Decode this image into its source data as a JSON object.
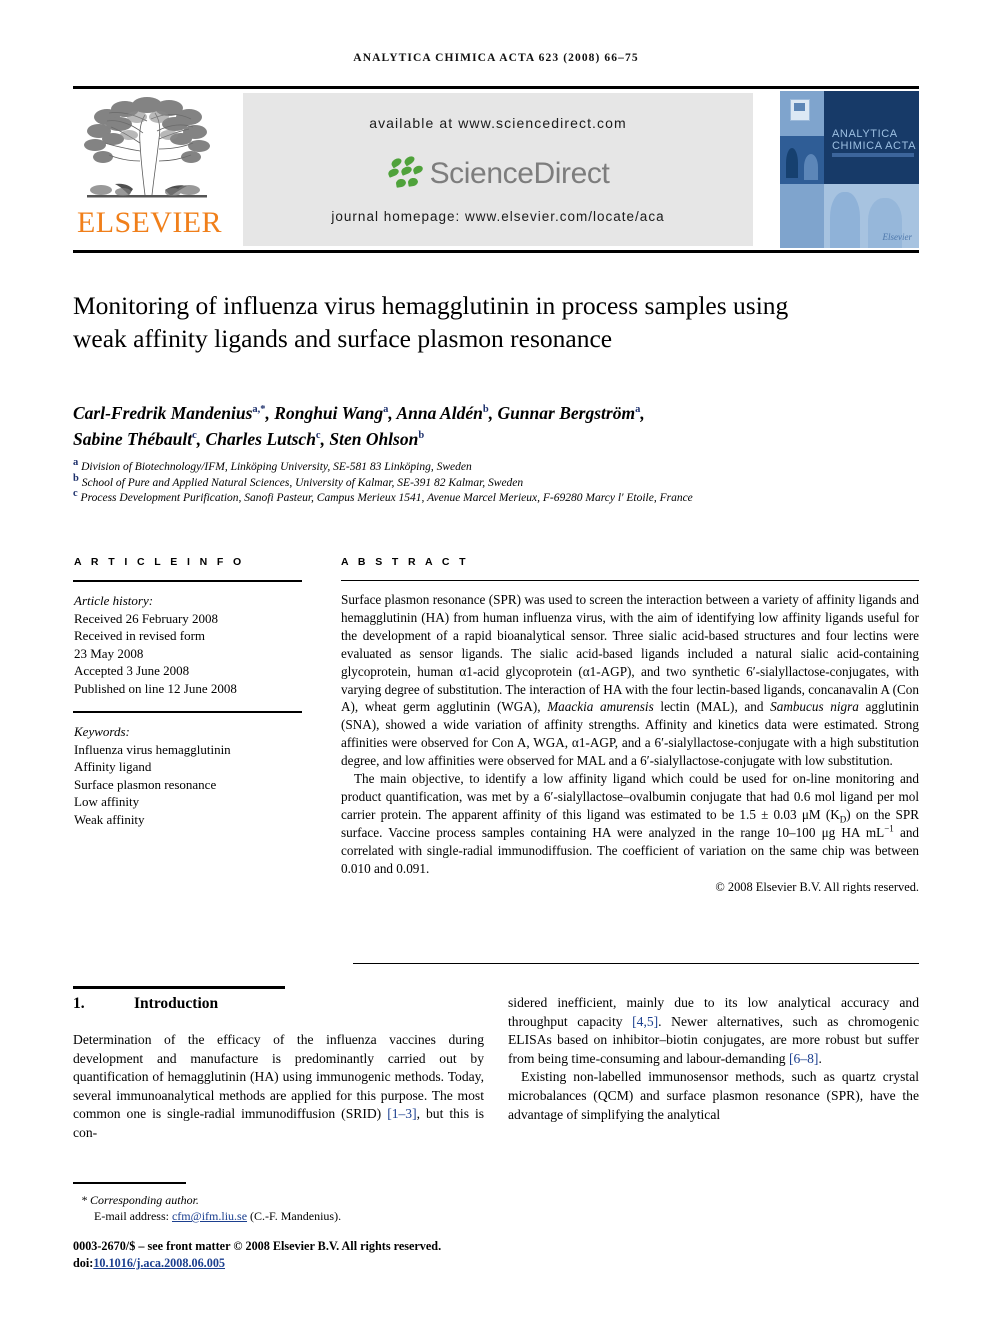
{
  "running_head": "ANALYTICA CHIMICA ACTA 623 (2008) 66–75",
  "masthead": {
    "available_at": "available at www.sciencedirect.com",
    "sciencedirect_wordmark": "ScienceDirect",
    "journal_homepage": "journal homepage: www.elsevier.com/locate/aca",
    "publisher_wordmark": "ELSEVIER",
    "cover": {
      "title_line1": "ANALYTICA",
      "title_line2": "CHIMICA ACTA",
      "brand": "Elsevier"
    }
  },
  "article": {
    "title": "Monitoring of influenza virus hemagglutinin in process samples using weak affinity ligands and surface plasmon resonance",
    "authors_line1": "Carl-Fredrik Mandenius<sup>a,*</sup>, Ronghui Wang<sup>a</sup>, Anna Aldén<sup>b</sup>, Gunnar Bergström<sup>a</sup>,",
    "authors_line2": "Sabine Thébault<sup>c</sup>, Charles Lutsch<sup>c</sup>, Sten Ohlson<sup>b</sup>",
    "affiliations": [
      "<sup>a</sup> Division of Biotechnology/IFM, Linköping University, SE-581 83 Linköping, Sweden",
      "<sup>b</sup> School of Pure and Applied Natural Sciences, University of Kalmar, SE-391 82 Kalmar, Sweden",
      "<sup>c</sup> Process Development Purification, Sanofi Pasteur, Campus Merieux 1541, Avenue Marcel Merieux, F-69280 Marcy l' Etoile, France"
    ]
  },
  "article_info": {
    "heading": "A R T I C L E   I N F O",
    "history_label": "Article history:",
    "history": [
      "Received 26 February 2008",
      "Received in revised form",
      "23 May 2008",
      "Accepted 3 June 2008",
      "Published on line 12 June 2008"
    ],
    "keywords_label": "Keywords:",
    "keywords": [
      "Influenza virus hemagglutinin",
      "Affinity ligand",
      "Surface plasmon resonance",
      "Low affinity",
      "Weak affinity"
    ]
  },
  "abstract": {
    "heading": "A B S T R A C T",
    "paragraph1_html": "Surface plasmon resonance (SPR) was used to screen the interaction between a variety of affinity ligands and hemagglutinin (HA) from human influenza virus, with the aim of identifying low affinity ligands useful for the development of a rapid bioanalytical sensor. Three sialic acid-based structures and four lectins were evaluated as sensor ligands. The sialic acid-based ligands included a natural sialic acid-containing glycoprotein, human α1-acid glycoprotein (α1-AGP), and two synthetic 6′-sialyllactose-conjugates, with varying degree of substitution. The interaction of HA with the four lectin-based ligands, concanavalin A (Con A), wheat germ agglutinin (WGA), <i>Maackia amurensis</i> lectin (MAL), and <i>Sambucus nigra</i> agglutinin (SNA), showed a wide variation of affinity strengths. Affinity and kinetics data were estimated. Strong affinities were observed for Con A, WGA, α1-AGP, and a 6′-sialyllactose-conjugate with a high substitution degree, and low affinities were observed for MAL and a 6′-sialyllactose-conjugate with low substitution.",
    "paragraph2_html": "The main objective, to identify a low affinity ligand which could be used for on-line monitoring and product quantification, was met by a 6′-sialyllactose–ovalbumin conjugate that had 0.6 mol ligand per mol carrier protein. The apparent affinity of this ligand was estimated to be 1.5 ± 0.03 μM (K<sub>D</sub>) on the SPR surface. Vaccine process samples containing HA were analyzed in the range 10–100 μg HA mL<sup class=\"ex\">−1</sup> and correlated with single-radial immunodiffusion. The coefficient of variation on the same chip was between 0.010 and 0.091.",
    "copyright": "© 2008 Elsevier B.V. All rights reserved."
  },
  "section": {
    "number": "1.",
    "title": "Introduction",
    "left_column_html": "Determination of the efficacy of the influenza vaccines during development and manufacture is predominantly carried out by quantification of hemagglutinin (HA) using immunogenic methods. Today, several immunoanalytical methods are applied for this purpose. The most common one is single-radial immunodiffusion (SRID) <span class=\"ref\">[1–3]</span>, but this is con-",
    "right_column_p1_html": "sidered inefficient, mainly due to its low analytical accuracy and throughput capacity <span class=\"ref\">[4,5]</span>. Newer alternatives, such as chromogenic ELISAs based on inhibitor–biotin conjugates, are more robust but suffer from being time-consuming and labour-demanding <span class=\"ref\">[6–8]</span>.",
    "right_column_p2_html": "Existing non-labelled immunosensor methods, such as quartz crystal microbalances (QCM) and surface plasmon resonance (SPR), have the advantage of simplifying the analytical"
  },
  "footer": {
    "corresponding_author": "* Corresponding author.",
    "email_prefix": "E-mail address: ",
    "email": "cfm@ifm.liu.se",
    "email_suffix": " (C.-F. Mandenius).",
    "issn_line": "0003-2670/$ – see front matter © 2008 Elsevier B.V. All rights reserved.",
    "doi_prefix": "doi:",
    "doi": "10.1016/j.aca.2008.06.005"
  }
}
